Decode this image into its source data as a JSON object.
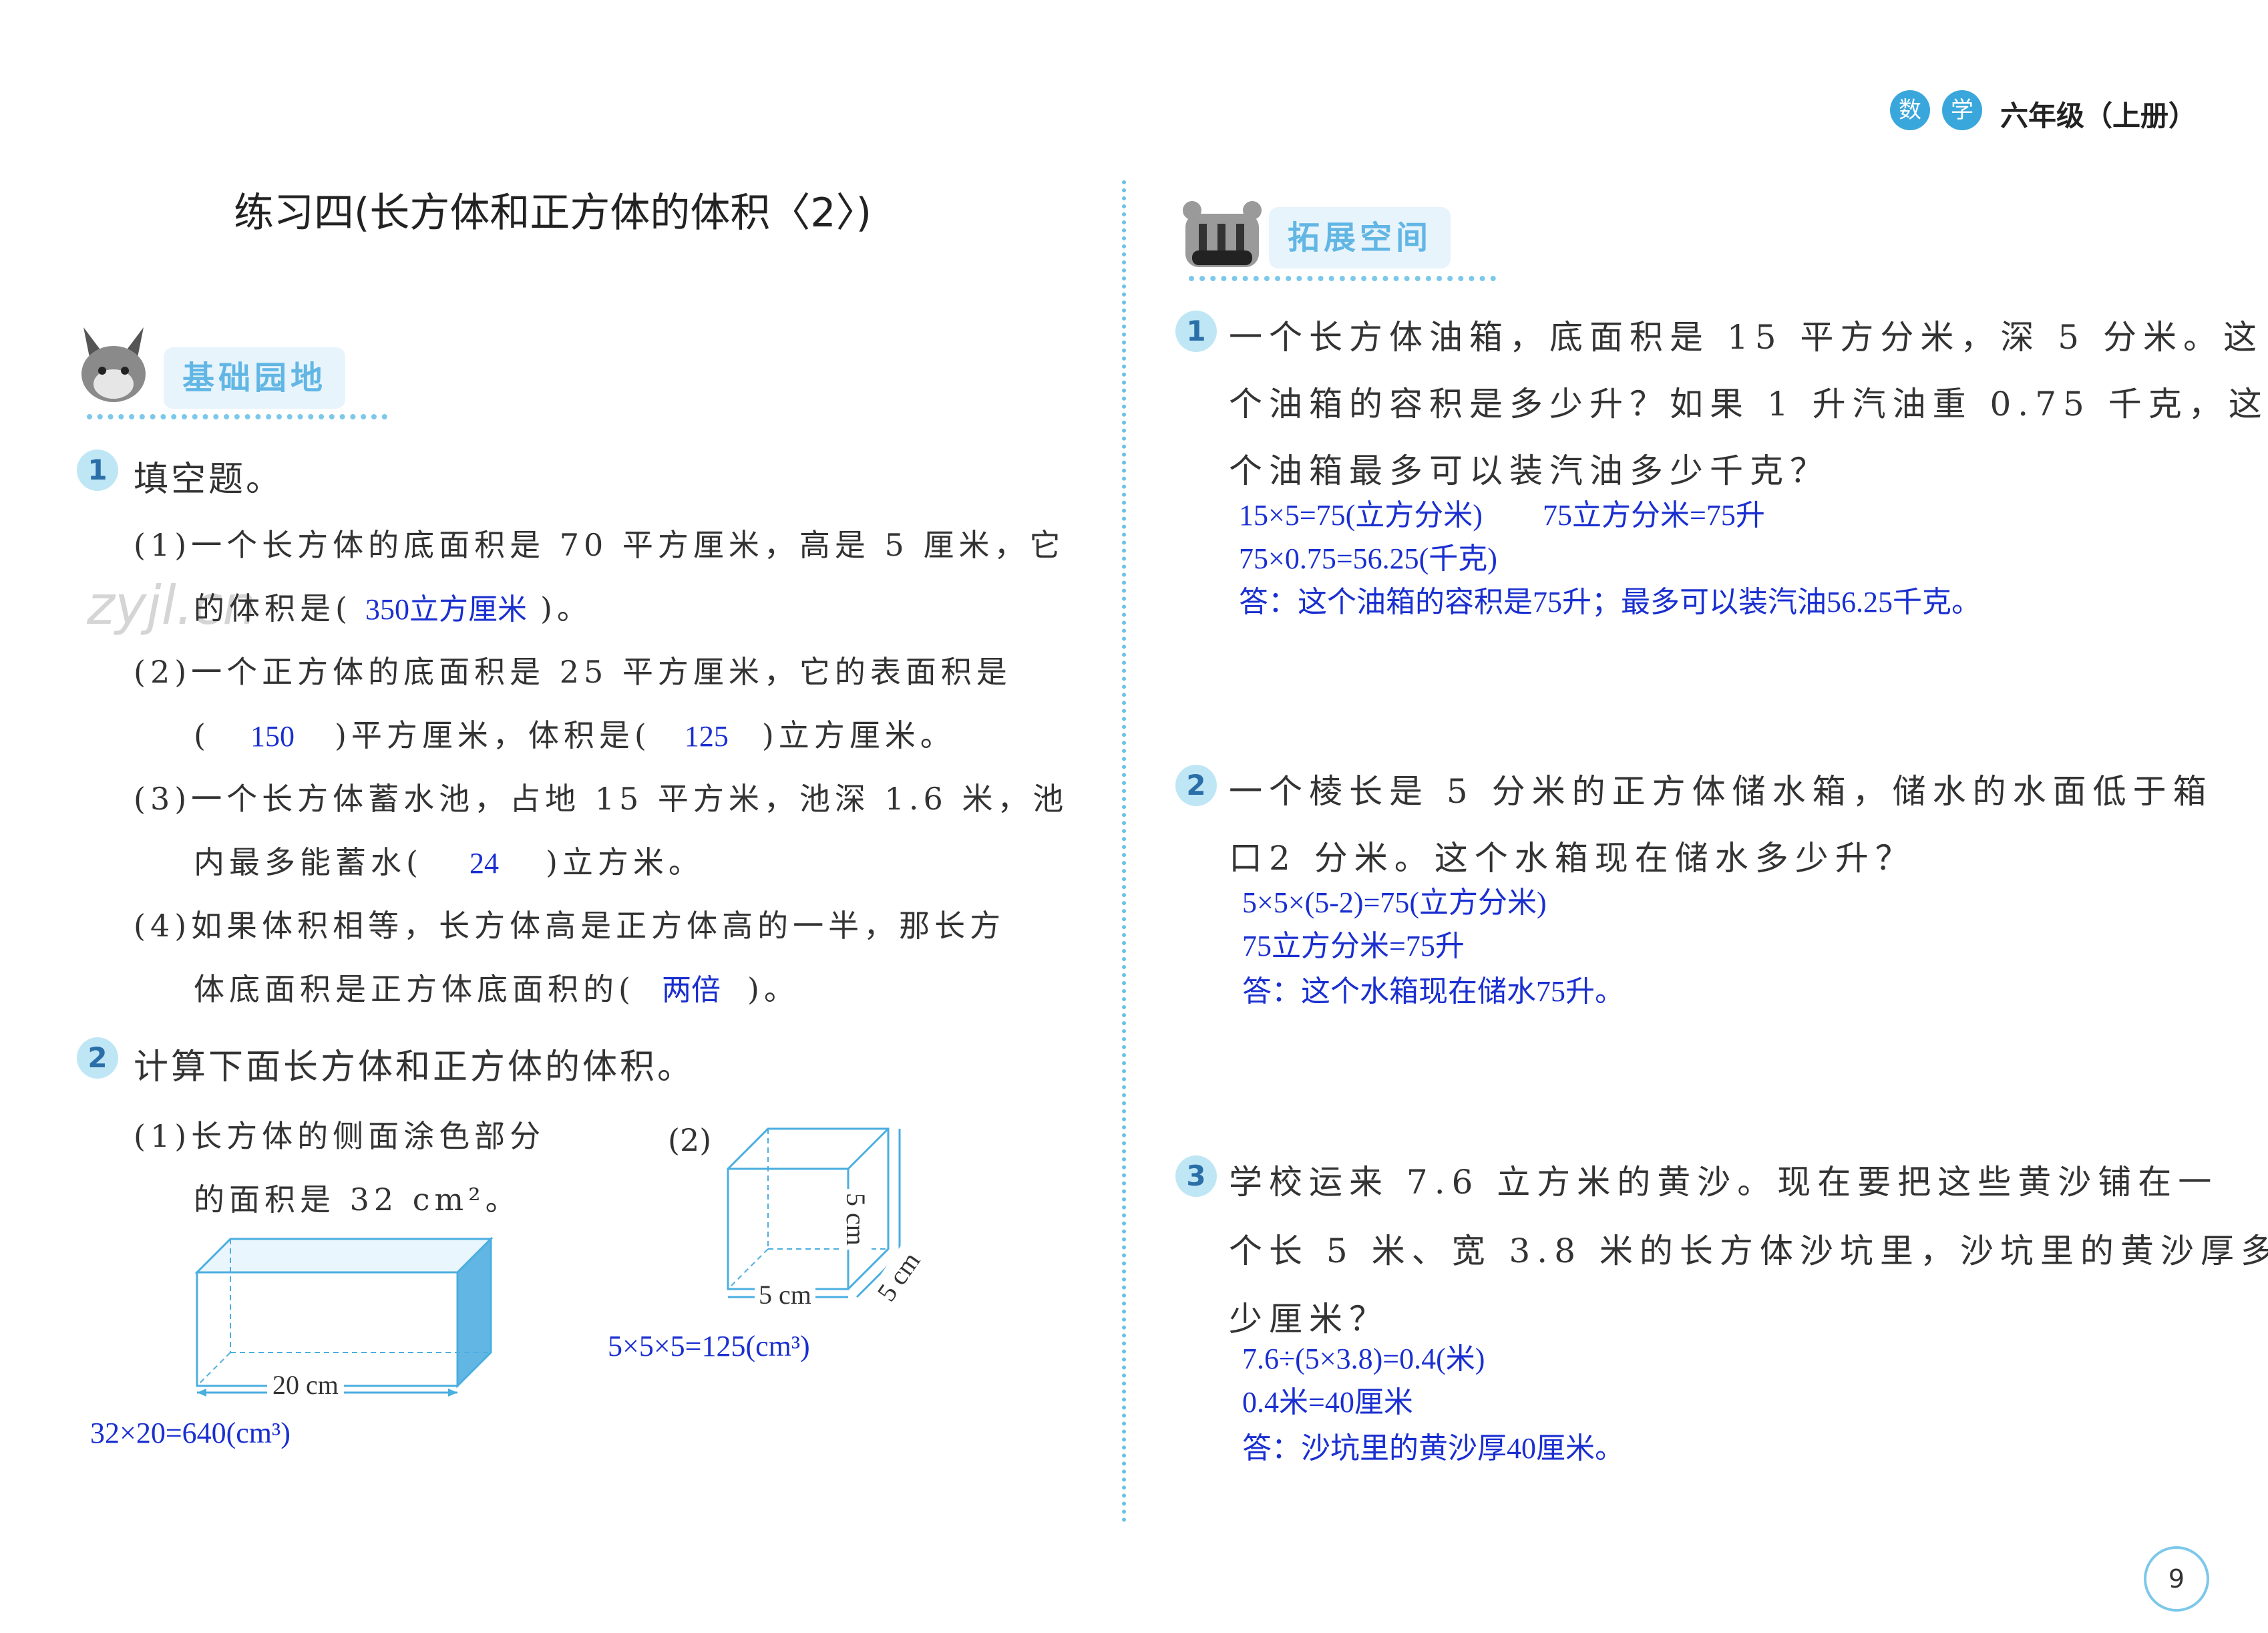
{
  "header": {
    "badge1": "数",
    "badge2": "学",
    "grade": "六年级（上册）"
  },
  "title": "练习四(长方体和正方体的体积〈2〉)",
  "watermark": "zyjl.cn",
  "left": {
    "section": "基础园地",
    "q1": {
      "num": "1",
      "label": "填空题。",
      "p1_line1": "(1)一个长方体的底面积是 70 平方厘米，高是 5 厘米，它",
      "p1_line2_pre": "的体积是(",
      "p1_ans": "350立方厘米",
      "p1_line2_post": ")。",
      "p2_line1": "(2)一个正方体的底面积是 25 平方厘米，它的表面积是",
      "p2_pre": "(",
      "p2_ans1": "150",
      "p2_mid": ")平方厘米，体积是(",
      "p2_ans2": "125",
      "p2_post": ")立方厘米。",
      "p3_line1": "(3)一个长方体蓄水池，占地 15 平方米，池深 1.6 米，池",
      "p3_pre": "内最多能蓄水(",
      "p3_ans": "24",
      "p3_post": ")立方米。",
      "p4_line1": "(4)如果体积相等，长方体高是正方体高的一半，那长方",
      "p4_pre": "体底面积是正方体底面积的(",
      "p4_ans": "两倍",
      "p4_post": ")。"
    },
    "q2": {
      "num": "2",
      "label": "计算下面长方体和正方体的体积。",
      "sub1_line1": "(1)长方体的侧面涂色部分",
      "sub1_line2": "的面积是 32 cm²。",
      "sub1_dim": "20 cm",
      "sub1_ans": "32×20=640(cm³)",
      "sub2_label": "(2)",
      "sub2_dim_h": "5 cm",
      "sub2_dim_d": "5 cm",
      "sub2_dim_w": "5 cm",
      "sub2_ans": "5×5×5=125(cm³)"
    }
  },
  "right": {
    "section": "拓展空间",
    "q1": {
      "num": "1",
      "line1": "一个长方体油箱，底面积是 15 平方分米，深 5 分米。这",
      "line2": "个油箱的容积是多少升？如果 1 升汽油重 0.75 千克，这",
      "line3": "个油箱最多可以装汽油多少千克？",
      "ans1a": "15×5=75(立方分米)",
      "ans1b": "75立方分米=75升",
      "ans2": "75×0.75=56.25(千克)",
      "ans3": "答：这个油箱的容积是75升；最多可以装汽油56.25千克。"
    },
    "q2": {
      "num": "2",
      "line1": "一个棱长是 5 分米的正方体储水箱，储水的水面低于箱",
      "line2": "口2 分米。这个水箱现在储水多少升？",
      "ans1": "5×5×(5-2)=75(立方分米)",
      "ans2": "75立方分米=75升",
      "ans3": "答：这个水箱现在储水75升。"
    },
    "q3": {
      "num": "3",
      "line1": "学校运来 7.6 立方米的黄沙。现在要把这些黄沙铺在一",
      "line2": "个长 5 米、宽 3.8 米的长方体沙坑里，沙坑里的黄沙厚多",
      "line3": "少厘米？",
      "ans1": "7.6÷(5×3.8)=0.4(米)",
      "ans2": "0.4米=40厘米",
      "ans3": "答：沙坑里的黄沙厚40厘米。"
    }
  },
  "page_number": "9",
  "colors": {
    "accent": "#3aa7dc",
    "answer": "#1a2fd0",
    "tag_bg": "#e7f4fc"
  }
}
